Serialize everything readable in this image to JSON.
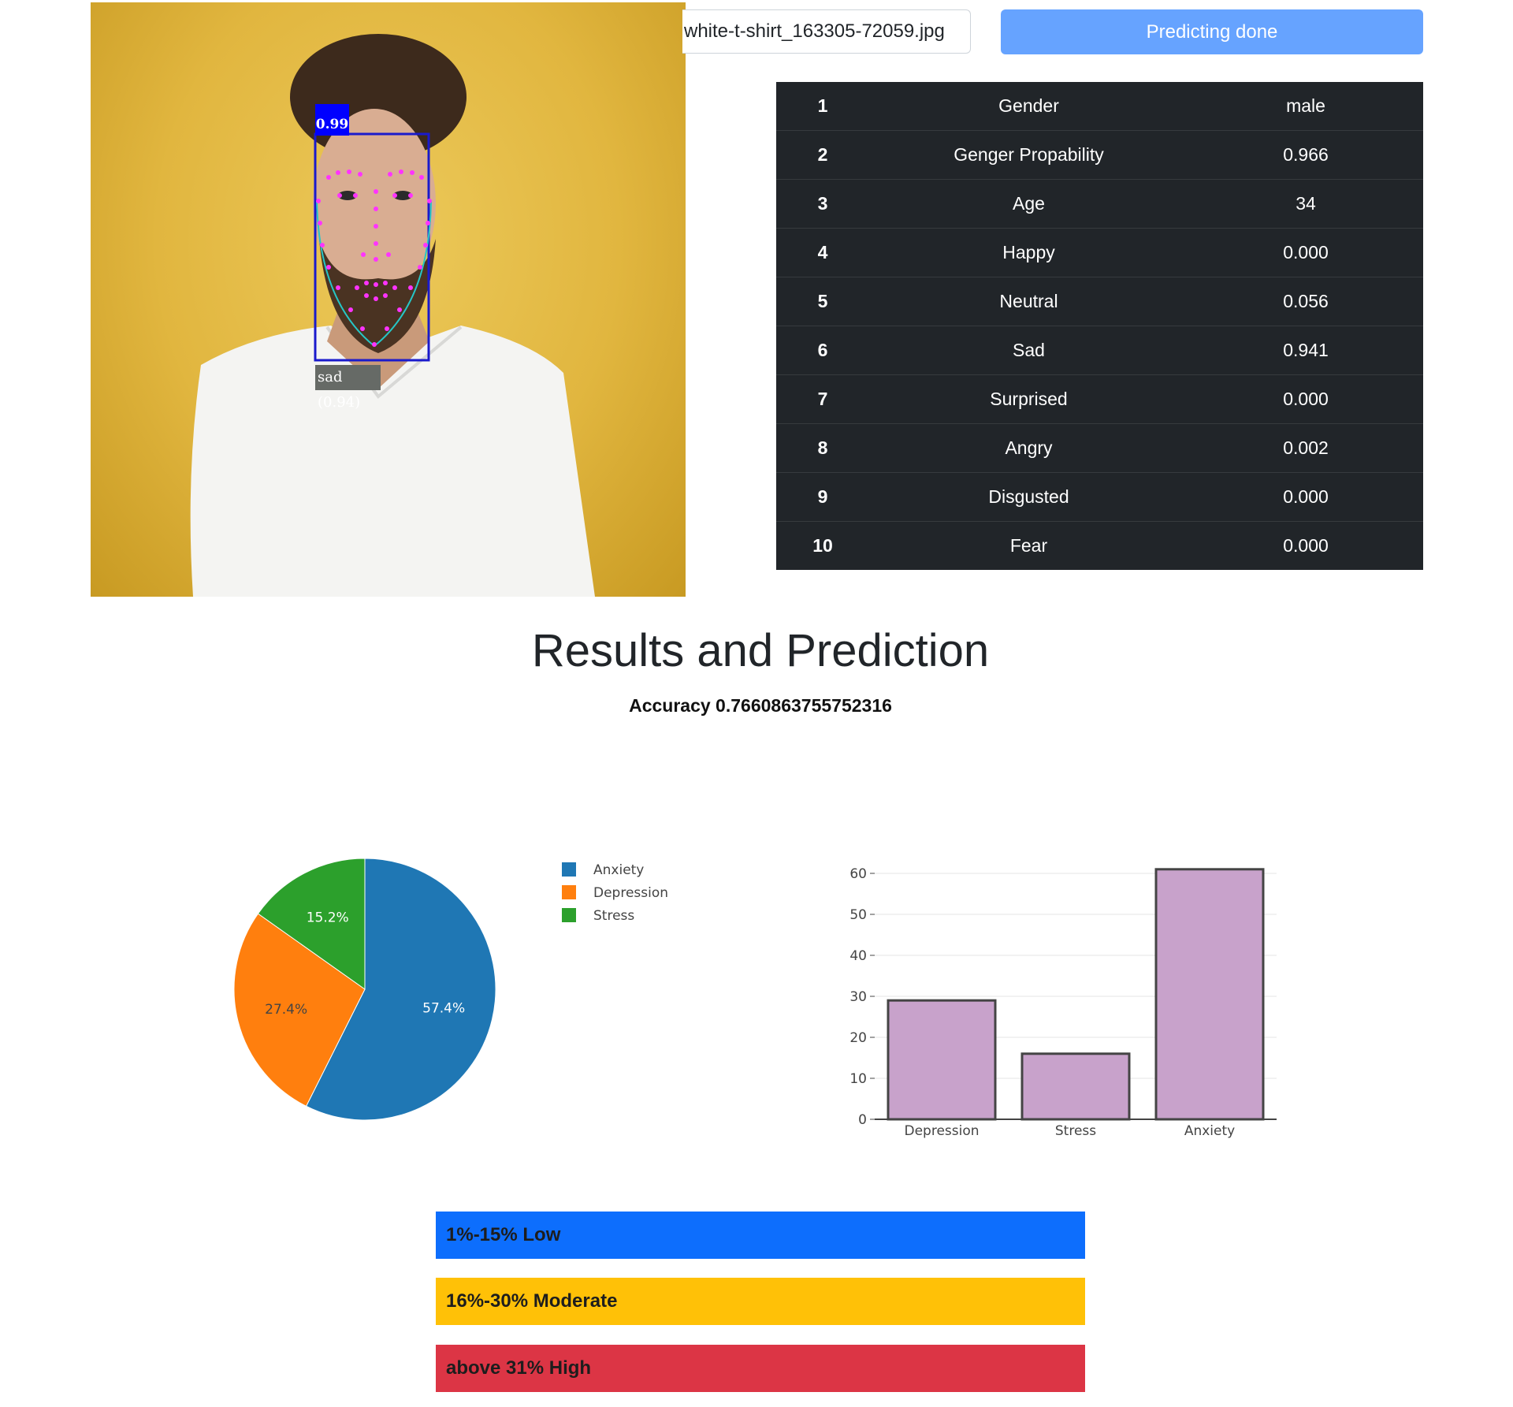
{
  "image": {
    "detection_score": "0.99",
    "emotion_label": "sad (0.94)"
  },
  "upload": {
    "filename": "white-t-shirt_163305-72059.jpg",
    "button_label": "Predicting done"
  },
  "results_table": [
    {
      "index": "1",
      "name": "Gender",
      "value": "male"
    },
    {
      "index": "2",
      "name": "Genger Propability",
      "value": "0.966"
    },
    {
      "index": "3",
      "name": "Age",
      "value": "34"
    },
    {
      "index": "4",
      "name": "Happy",
      "value": "0.000"
    },
    {
      "index": "5",
      "name": "Neutral",
      "value": "0.056"
    },
    {
      "index": "6",
      "name": "Sad",
      "value": "0.941"
    },
    {
      "index": "7",
      "name": "Surprised",
      "value": "0.000"
    },
    {
      "index": "8",
      "name": "Angry",
      "value": "0.002"
    },
    {
      "index": "9",
      "name": "Disgusted",
      "value": "0.000"
    },
    {
      "index": "10",
      "name": "Fear",
      "value": "0.000"
    }
  ],
  "heading": {
    "title": "Results and Prediction",
    "accuracy": "Accuracy 0.7660863755752316"
  },
  "chart_data": [
    {
      "type": "pie",
      "labels": [
        "Anxiety",
        "Depression",
        "Stress"
      ],
      "values": [
        57.4,
        27.4,
        15.2
      ],
      "display_labels": [
        "57.4%",
        "27.4%",
        "15.2%"
      ],
      "colors": [
        "#1f77b4",
        "#ff7f0e",
        "#2ca02c"
      ],
      "legend": "right"
    },
    {
      "type": "bar",
      "categories": [
        "Depression",
        "Stress",
        "Anxiety"
      ],
      "values": [
        29,
        16,
        61
      ],
      "ylim": [
        0,
        60
      ],
      "yticks": [
        0,
        10,
        20,
        30,
        40,
        50,
        60
      ],
      "bar_color": "#c8a2cb",
      "edge_color": "#444444",
      "grid": true
    }
  ],
  "severity_levels": [
    {
      "label": "1%-15% Low",
      "color": "#0d6efd"
    },
    {
      "label": "16%-30% Moderate",
      "color": "#ffc107"
    },
    {
      "label": "above 31% High",
      "color": "#dc3545"
    }
  ]
}
